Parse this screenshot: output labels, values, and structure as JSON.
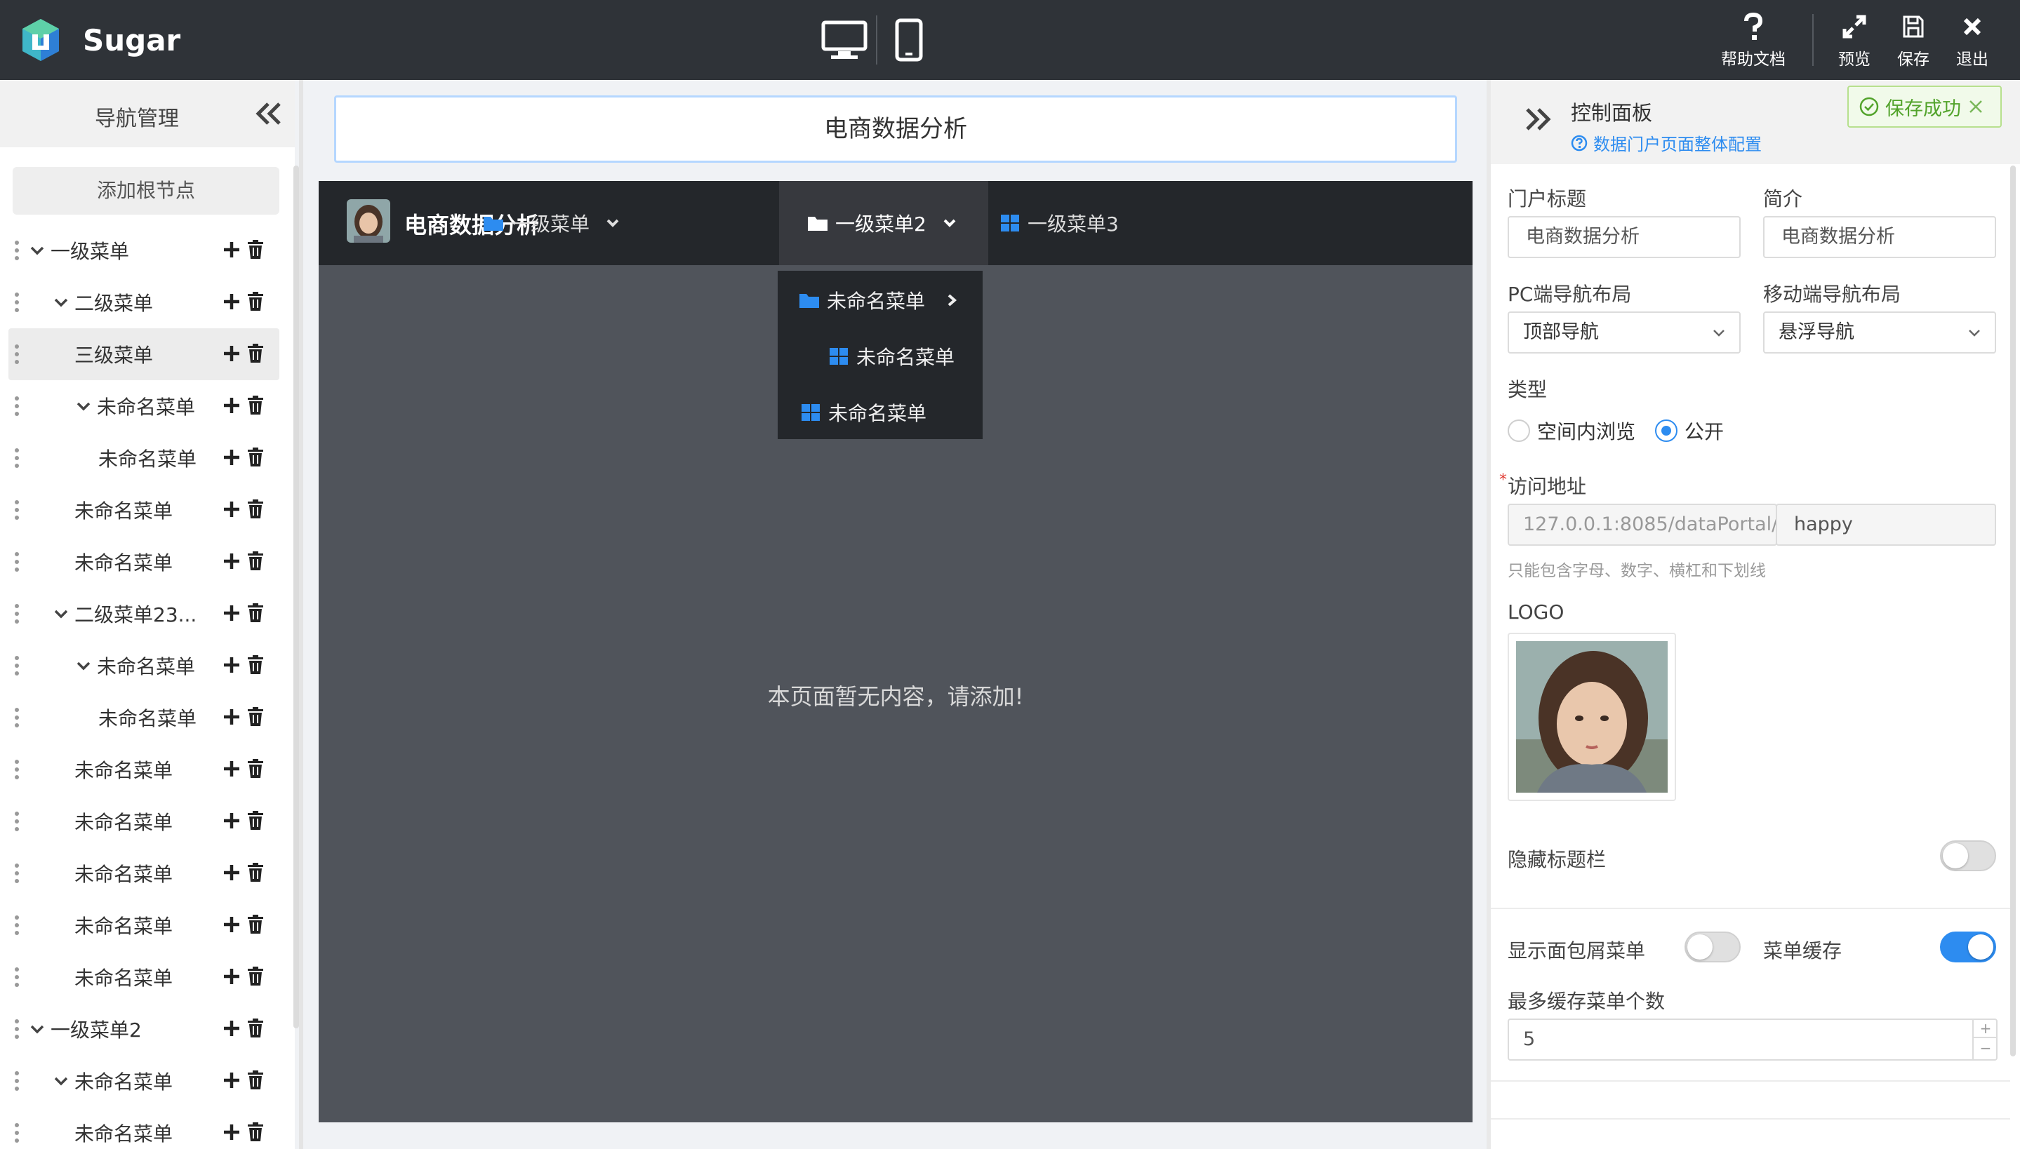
{
  "app": {
    "name": "Sugar"
  },
  "topbar": {
    "actions": [
      {
        "id": "help",
        "label": "帮助文档"
      },
      {
        "id": "preview",
        "label": "预览"
      },
      {
        "id": "save",
        "label": "保存"
      },
      {
        "id": "exit",
        "label": "退出"
      }
    ]
  },
  "nav_panel": {
    "title": "导航管理",
    "add_root": "添加根节点",
    "tree": [
      {
        "label": "一级菜单",
        "depth": 0,
        "expanded": true
      },
      {
        "label": "二级菜单",
        "depth": 1,
        "expanded": true
      },
      {
        "label": "三级菜单",
        "depth": 2,
        "active": true
      },
      {
        "label": "未命名菜单",
        "depth": 2,
        "expanded": true
      },
      {
        "label": "未命名菜单",
        "depth": 3
      },
      {
        "label": "未命名菜单",
        "depth": 2
      },
      {
        "label": "未命名菜单",
        "depth": 2
      },
      {
        "label": "二级菜单23...",
        "depth": 1,
        "expanded": true
      },
      {
        "label": "未命名菜单",
        "depth": 2,
        "expanded": true
      },
      {
        "label": "未命名菜单",
        "depth": 3
      },
      {
        "label": "未命名菜单",
        "depth": 1
      },
      {
        "label": "未命名菜单",
        "depth": 1
      },
      {
        "label": "未命名菜单",
        "depth": 1
      },
      {
        "label": "未命名菜单",
        "depth": 1
      },
      {
        "label": "未命名菜单",
        "depth": 1
      },
      {
        "label": "一级菜单2",
        "depth": 0,
        "expanded": true
      },
      {
        "label": "未命名菜单",
        "depth": 1,
        "expanded": true
      },
      {
        "label": "未命名菜单",
        "depth": 2
      }
    ]
  },
  "center": {
    "title_value": "电商数据分析",
    "preview": {
      "portal_title": "电商数据分析",
      "menus": [
        {
          "label": "一级菜单",
          "icon": "folder-icon",
          "has_children": true
        },
        {
          "label": "一级菜单2",
          "icon": "folder-icon",
          "has_children": true,
          "selected": true
        },
        {
          "label": "一级菜单3",
          "icon": "grid-icon",
          "has_children": false
        }
      ],
      "dropdown": [
        {
          "label": "未命名菜单",
          "icon": "folder-icon"
        },
        {
          "label": "未命名菜单",
          "icon": "grid-icon"
        },
        {
          "label": "未命名菜单",
          "icon": "grid-icon"
        }
      ],
      "empty_message": "本页面暂无内容，请添加!"
    }
  },
  "control_panel": {
    "title": "控制面板",
    "subtitle": "数据门户页面整体配置",
    "toast": "保存成功",
    "portal_title_label": "门户标题",
    "portal_title_value": "电商数据分析",
    "intro_label": "简介",
    "intro_value": "电商数据分析",
    "pc_layout_label": "PC端导航布局",
    "pc_layout_value": "顶部导航",
    "mobile_layout_label": "移动端导航布局",
    "mobile_layout_value": "悬浮导航",
    "type_label": "类型",
    "type_options": [
      "空间内浏览",
      "公开"
    ],
    "type_selected": "公开",
    "url_required": "*",
    "url_label": "访问地址",
    "url_prefix": "127.0.0.1:8085/dataPortal/",
    "url_value": "happy",
    "url_hint": "只能包含字母、数字、横杠和下划线",
    "logo_label": "LOGO",
    "hide_title_label": "隐藏标题栏",
    "hide_title_on": false,
    "breadcrumb_label": "显示面包屑菜单",
    "breadcrumb_on": false,
    "cache_label": "菜单缓存",
    "cache_on": true,
    "max_cache_label": "最多缓存菜单个数",
    "max_cache_value": "5",
    "stepper_up": "+",
    "stepper_down": "−"
  },
  "colors": {
    "accent": "#2d8cf0",
    "topbar": "#2f3338",
    "preview_nav": "#24272b",
    "preview_bg": "#50545b",
    "success": "#52a32b"
  }
}
